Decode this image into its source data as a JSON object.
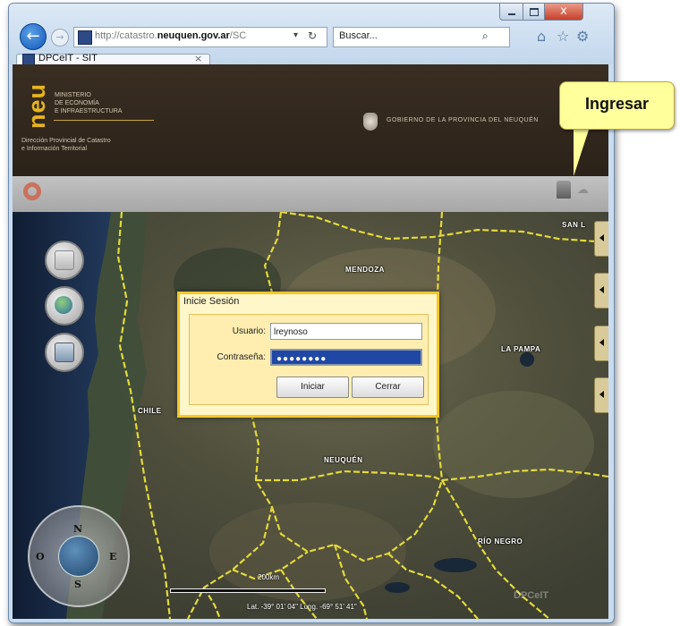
{
  "browser": {
    "url_prefix": "http://catastro.",
    "url_domain": "neuquen.gov.ar",
    "url_suffix": "/SC",
    "search_placeholder": "Buscar...",
    "tab_title": "DPCeIT - SIT",
    "tab_close": "×",
    "close_glyph": "x",
    "back_glyph": "←",
    "forward_glyph": "→",
    "dropdown_glyph": "▾",
    "refresh_glyph": "↻",
    "search_glyph": "⌕",
    "toolbar_icons": [
      "home-icon",
      "favorites-icon",
      "settings-icon"
    ],
    "toolbar_glyphs": [
      "⌂",
      "☆",
      "⚙"
    ]
  },
  "header": {
    "logo_text": "neu",
    "ministry_lines": [
      "MINISTERIO",
      "DE ECONOMÍA",
      "E INFRAESTRUCTURA"
    ],
    "direction_lines": [
      "Dirección Provincial de Catastro",
      "e Información Territorial"
    ],
    "government": "GOBIERNO DE LA PROVINCIA DEL NEUQUÉN"
  },
  "map": {
    "labels": [
      "MENDOZA",
      "LA PAMPA",
      "CHILE",
      "NEUQUÉN",
      "RÍO NEGRO",
      "SAN L"
    ],
    "compass": {
      "n": "N",
      "s": "S",
      "e": "E",
      "o": "O"
    },
    "scale_label": "200km",
    "coordinates": "Lat. -39° 01' 04\"  Long. -69° 51' 41\"",
    "watermark": "DPCeIT"
  },
  "login": {
    "title": "Inicie Sesión",
    "user_label": "Usuario:",
    "user_value": "lreynoso",
    "password_label": "Contraseña:",
    "password_value": "●●●●●●●●",
    "submit_label": "Iniciar",
    "close_label": "Cerrar"
  },
  "callout": {
    "text": "Ingresar"
  },
  "colors": {
    "dialog_border": "#f3c62c",
    "boundary_line": "#e3d93a",
    "banner": "#33281d",
    "callout": "#ffff9c"
  }
}
